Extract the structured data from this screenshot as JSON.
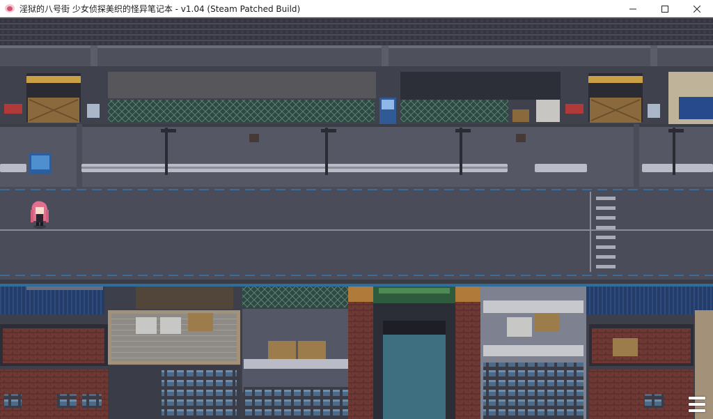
{
  "window": {
    "title": "淫狱的八号街 少女侦探美织的怪异笔记本 - v1.04 (Steam Patched Build)",
    "controls": [
      "minimize-icon",
      "maximize-icon",
      "close-icon"
    ]
  },
  "game": {
    "scene": "night city street",
    "colors": {
      "road": "#4a4c59",
      "sidewalk": "#5a5c69",
      "wall": "#3f414d",
      "rail": "#2f3039",
      "fence": "#3e5f55",
      "water": "#3d6f80",
      "brick": "#7a3f3a",
      "character_hair": "#e0708c"
    },
    "menu_icon": "hamburger-menu-icon"
  }
}
